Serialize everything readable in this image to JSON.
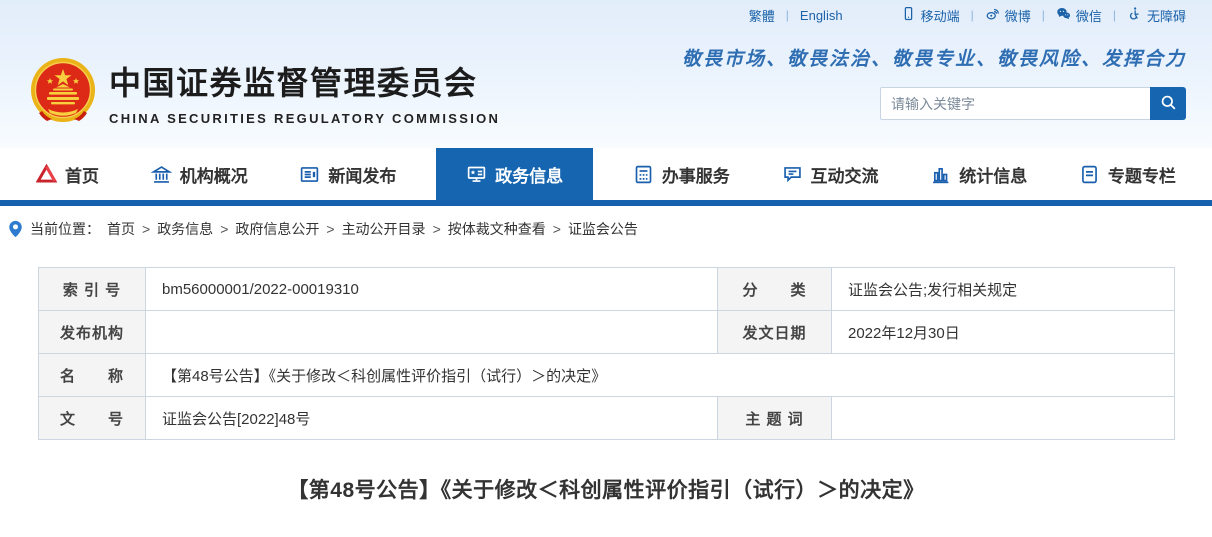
{
  "theme": {
    "accent_blue": "#1565b0",
    "nav_bar_blue": "#1561ae",
    "topbar_link_blue": "#1b62a9",
    "slogan_blue": "#2f6eb3",
    "table_border": "#ccd6e0",
    "label_cell_bg": "#f4f4f4"
  },
  "topbar": {
    "lang_traditional": "繁體",
    "lang_english": "English",
    "separator": "|",
    "links": [
      {
        "icon": "mobile-icon",
        "label": "移动端"
      },
      {
        "icon": "weibo-icon",
        "label": "微博"
      },
      {
        "icon": "wechat-icon",
        "label": "微信"
      },
      {
        "icon": "accessibility-icon",
        "label": "无障碍"
      }
    ]
  },
  "header": {
    "title_cn": "中国证券监督管理委员会",
    "title_en": "CHINA SECURITIES REGULATORY COMMISSION",
    "slogan": "敬畏市场、敬畏法治、敬畏专业、敬畏风险、发挥合力",
    "search": {
      "placeholder": "请输入关键字"
    }
  },
  "nav": {
    "items": [
      {
        "label": "首页",
        "icon": "csrc-logo-icon",
        "active": false
      },
      {
        "label": "机构概况",
        "icon": "bank-icon",
        "active": false
      },
      {
        "label": "新闻发布",
        "icon": "news-icon",
        "active": false
      },
      {
        "label": "政务信息",
        "icon": "monitor-star-icon",
        "active": true
      },
      {
        "label": "办事服务",
        "icon": "services-icon",
        "active": false
      },
      {
        "label": "互动交流",
        "icon": "chat-icon",
        "active": false
      },
      {
        "label": "统计信息",
        "icon": "bar-chart-icon",
        "active": false
      },
      {
        "label": "专题专栏",
        "icon": "topics-icon",
        "active": false
      }
    ]
  },
  "breadcrumb": {
    "prefix": "当前位置：",
    "separator": ">",
    "items": [
      "首页",
      "政务信息",
      "政府信息公开",
      "主动公开目录",
      "按体裁文种查看",
      "证监会公告"
    ]
  },
  "info_table": {
    "rows": [
      {
        "label1": "索 引 号",
        "value1": "bm56000001/2022-00019310",
        "label2": "分　　类",
        "value2": "证监会公告;发行相关规定"
      },
      {
        "label1": "发布机构",
        "value1": "",
        "label2": "发文日期",
        "value2": "2022年12月30日"
      },
      {
        "label1": "名　　称",
        "value1": "【第48号公告】《关于修改＜科创属性评价指引（试行）＞的决定》"
      },
      {
        "label1": "文　　号",
        "value1": "证监会公告[2022]48号",
        "label2": "主 题 词",
        "value2": ""
      }
    ]
  },
  "article": {
    "title": "【第48号公告】《关于修改＜科创属性评价指引（试行）＞的决定》"
  }
}
